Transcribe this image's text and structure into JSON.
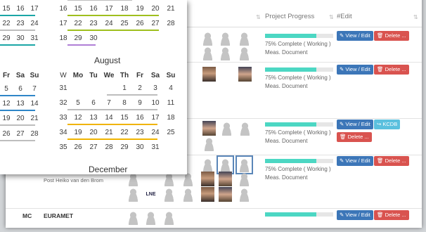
{
  "table": {
    "headers": {
      "progress": "Project Progress",
      "edit": "#Edit"
    },
    "rows": [
      {
        "progress": 0.75,
        "status": "75% Complete ( Working )",
        "doc": "Meas. Document"
      },
      {
        "progress": 0.75,
        "status": "75% Complete ( Working )",
        "doc": "Meas. Document"
      },
      {
        "progress": 0.75,
        "status": "75% Complete ( Working )",
        "doc": "Meas. Document"
      },
      {
        "progress": 0.75,
        "status": "75% Complete ( Working )",
        "doc": "Meas. Document"
      },
      {
        "progress": 0.75,
        "status": "",
        "doc": ""
      }
    ],
    "buttons": {
      "view_edit": "✎ View / Edit",
      "delete": "🗑 Delete ...",
      "kcdb": "↪ KCDB"
    },
    "row_text": {
      "post_person": "Post Heiko van den Brom",
      "org_code": "MC",
      "org": "EURAMET",
      "logo": "LNE"
    }
  },
  "calendar": {
    "partial_headers": [
      "Fr",
      "Sa",
      "Su"
    ],
    "partial_rows": [
      {
        "days": [
          "",
          "15",
          "16",
          "17"
        ]
      },
      {
        "days": [
          "",
          "22",
          "23",
          "24"
        ]
      },
      {
        "days": [
          "",
          "29",
          "30",
          "31"
        ]
      },
      {
        "days": [
          "",
          "",
          "",
          ""
        ]
      },
      {
        "days": [
          "",
          "",
          "",
          ""
        ]
      },
      {
        "days": [
          "",
          "5",
          "6",
          "7"
        ]
      },
      {
        "days": [
          "",
          "12",
          "13",
          "14"
        ]
      },
      {
        "days": [
          "",
          "19",
          "20",
          "21"
        ]
      },
      {
        "days": [
          "",
          "26",
          "27",
          "28"
        ]
      }
    ],
    "july_tail": [
      {
        "week": "16",
        "days": [
          "15",
          "16",
          "17",
          "18",
          "19",
          "20",
          "21"
        ]
      },
      {
        "week": "17",
        "days": [
          "22",
          "23",
          "24",
          "25",
          "26",
          "27",
          "28"
        ]
      },
      {
        "week": "18",
        "days": [
          "29",
          "30",
          "",
          "",
          "",
          "",
          ""
        ]
      }
    ],
    "august": {
      "title": "August",
      "headers": [
        "W",
        "Mo",
        "Tu",
        "We",
        "Th",
        "Fr",
        "Sa",
        "Su"
      ],
      "weeks": [
        {
          "week": "31",
          "days": [
            "",
            "",
            "",
            "1",
            "2",
            "3",
            "4"
          ]
        },
        {
          "week": "32",
          "days": [
            "5",
            "6",
            "7",
            "8",
            "9",
            "10",
            "11"
          ]
        },
        {
          "week": "33",
          "days": [
            "12",
            "13",
            "14",
            "15",
            "16",
            "17",
            "18"
          ]
        },
        {
          "week": "34",
          "days": [
            "19",
            "20",
            "21",
            "22",
            "23",
            "24",
            "25"
          ]
        },
        {
          "week": "35",
          "days": [
            "26",
            "27",
            "28",
            "29",
            "30",
            "31",
            ""
          ]
        }
      ]
    },
    "next_month_title": "December",
    "colors": {
      "green": "#9fbf1e",
      "blue": "#2f86c8",
      "teal": "#1ba6a6",
      "purple": "#b07fd6",
      "yellow": "#f0b400",
      "gray": "#bdbdbd"
    }
  }
}
